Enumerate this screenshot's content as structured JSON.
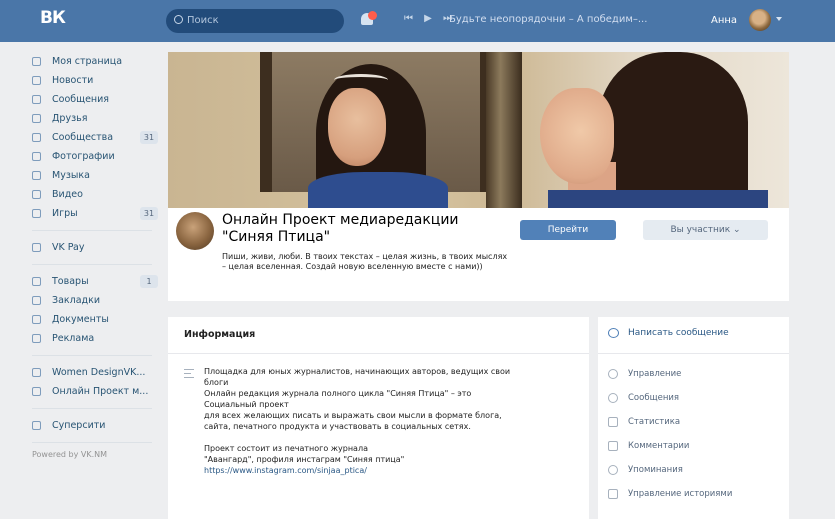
{
  "topbar": {
    "logo": "ВК",
    "search_placeholder": "Поиск",
    "player_controls": "⏮ ▶ ⏭",
    "track": "Будьте неопорядочни – А победим–...",
    "username": "Анна"
  },
  "sidebar": {
    "items": [
      {
        "label": "Моя страница",
        "count": ""
      },
      {
        "label": "Новости",
        "count": ""
      },
      {
        "label": "Сообщения",
        "count": ""
      },
      {
        "label": "Друзья",
        "count": ""
      },
      {
        "label": "Сообщества",
        "count": "31"
      },
      {
        "label": "Фотографии",
        "count": ""
      },
      {
        "label": "Музыка",
        "count": ""
      },
      {
        "label": "Видео",
        "count": ""
      },
      {
        "label": "Игры",
        "count": "31"
      }
    ],
    "pay": "VK Pay",
    "items2": [
      {
        "label": "Товары",
        "count": "1"
      },
      {
        "label": "Закладки",
        "count": ""
      },
      {
        "label": "Документы",
        "count": ""
      },
      {
        "label": "Реклама",
        "count": ""
      }
    ],
    "groups": [
      "Women DesignVK...",
      "Онлайн Проект м..."
    ],
    "extra": "Суперсити",
    "footer": "Powered by VK.NM"
  },
  "group": {
    "name": "Онлайн Проект медиаредакции \"Синяя Птица\"",
    "status": "Пиши, живи, люби. В твоих текстах – целая жизнь, в твоих мыслях – целая вселенная. Создай новую вселенную вместе с нами))",
    "go_button": "Перейти",
    "member_button": "Вы участник ⌄"
  },
  "info": {
    "title": "Информация",
    "lines": [
      "Площадка для юных журналистов, начинающих авторов, ведущих свои",
      "блоги",
      "Онлайн редакция журнала полного цикла \"Синяя Птица\" – это",
      "Социальный проект",
      "для всех желающих писать и выражать свои мысли в формате блога,",
      "сайта, печатного продукта и участвовать в социальных сетях."
    ],
    "lines2": [
      "Проект состоит из печатного журнала",
      "\"Авангард\", профиля инстаграм \"Синяя птица\""
    ],
    "link": "https://www.instagram.com/sinjaa_ptica/"
  },
  "rpanel": {
    "write": "Написать сообщение",
    "items": [
      "Управление",
      "Сообщения",
      "Статистика",
      "Комментарии",
      "Упоминания",
      "Управление историями"
    ]
  }
}
